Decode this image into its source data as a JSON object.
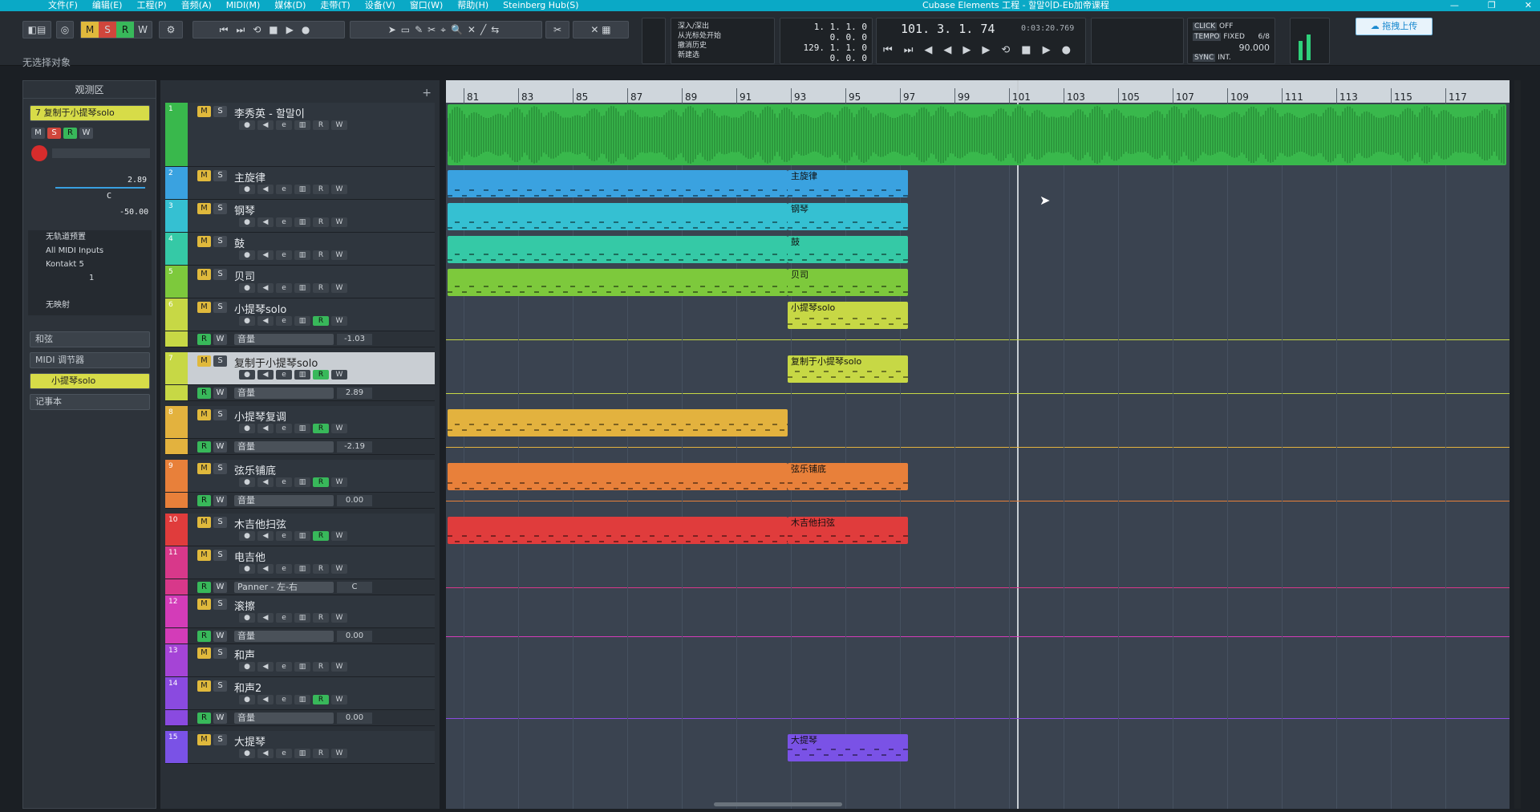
{
  "titlebar": {
    "menus": [
      "文件(F)",
      "编辑(E)",
      "工程(P)",
      "音频(A)",
      "MIDI(M)",
      "媒体(D)",
      "走带(T)",
      "设备(V)",
      "窗口(W)",
      "帮助(H)",
      "Steinberg Hub(S)"
    ],
    "title": "Cubase Elements 工程 - 할말이D-Eb加帝课程"
  },
  "toolbar": {
    "mode_buttons": [
      "M",
      "S",
      "R",
      "W"
    ],
    "no_selection": "无选择对象",
    "history": [
      "深入/深出",
      "从光标处开始",
      "撤消历史",
      "新建选"
    ],
    "left_locator": "1. 1. 1. 0",
    "left_locator2": "0. 0. 0",
    "right_locator": "129. 1. 1. 0",
    "right_locator2": "0. 0. 0",
    "position_bars": "101. 3. 1. 74",
    "position_time": "0:03:20.769",
    "click_label": "CLICK",
    "click_value": "OFF",
    "tempo_label": "TEMPO",
    "tempo_mode": "FIXED",
    "tempo_sig": "6/8",
    "tempo_value": "90.000",
    "sync_label": "SYNC",
    "sync_value": "INT.",
    "upload": "拖拽上传"
  },
  "inspector": {
    "header": "观测区",
    "track_name": "复制于小提琴solo",
    "track_no": "7",
    "volume": "2.89",
    "pan": "C",
    "extra": "-50.00",
    "input_none": "无轨道预置",
    "midi_input": "All MIDI Inputs",
    "instrument": "Kontakt 5",
    "channel": "1",
    "no_map": "无映射",
    "sections": [
      "和弦",
      "MIDI 调节器",
      "小提琴solo",
      "记事本"
    ]
  },
  "tracks": [
    {
      "no": "1",
      "name": "李秀英 - 할말이",
      "color": "#39b84c",
      "type": "audio"
    },
    {
      "no": "2",
      "name": "主旋律",
      "color": "#3aa2e0",
      "type": "midi"
    },
    {
      "no": "3",
      "name": "钢琴",
      "color": "#35c0d2",
      "type": "midi"
    },
    {
      "no": "4",
      "name": "鼓",
      "color": "#35c9a6",
      "type": "midi"
    },
    {
      "no": "5",
      "name": "贝司",
      "color": "#7dc93c",
      "type": "midi"
    },
    {
      "no": "6",
      "name": "小提琴solo",
      "color": "#c7d845",
      "type": "midi",
      "lane": "音量",
      "lane_val": "-1.03"
    },
    {
      "no": "7",
      "name": "复制于小提琴solo",
      "color": "#c7d845",
      "type": "midi",
      "lane": "音量",
      "lane_val": "2.89"
    },
    {
      "no": "8",
      "name": "小提琴复调",
      "color": "#e3b23e",
      "type": "midi",
      "lane": "音量",
      "lane_val": "-2.19"
    },
    {
      "no": "9",
      "name": "弦乐铺底",
      "color": "#e8803a",
      "type": "midi",
      "lane": "音量",
      "lane_val": "0.00"
    },
    {
      "no": "10",
      "name": "木吉他扫弦",
      "color": "#e03c3c",
      "type": "midi"
    },
    {
      "no": "11",
      "name": "电吉他",
      "color": "#d8388a",
      "type": "midi",
      "lane": "Panner - 左-右",
      "lane_val": "C"
    },
    {
      "no": "12",
      "name": "滚擦",
      "color": "#d33cb8",
      "type": "midi",
      "lane": "音量",
      "lane_val": "0.00"
    },
    {
      "no": "13",
      "name": "和声",
      "color": "#a544d6",
      "type": "midi"
    },
    {
      "no": "14",
      "name": "和声2",
      "color": "#8a4ae0",
      "type": "midi",
      "lane": "音量",
      "lane_val": "0.00"
    },
    {
      "no": "15",
      "name": "大提琴",
      "color": "#7a52e6",
      "type": "midi"
    }
  ],
  "ruler": [
    "81",
    "83",
    "85",
    "87",
    "89",
    "91",
    "93",
    "95",
    "97",
    "99",
    "101",
    "103",
    "105",
    "107",
    "109",
    "111",
    "113",
    "115",
    "117"
  ],
  "parts": [
    {
      "label": "主旋律",
      "color": "#3aa2e0"
    },
    {
      "label": "钢琴",
      "color": "#35c0d2"
    },
    {
      "label": "鼓",
      "color": "#35c9a6"
    },
    {
      "label": "贝司",
      "color": "#7dc93c"
    },
    {
      "label": "小提琴solo",
      "color": "#c7d845"
    },
    {
      "label": "复制于小提琴solo",
      "color": "#c7d845"
    },
    {
      "label": "弦乐铺底",
      "color": "#e8803a"
    },
    {
      "label": "木吉他扫弦",
      "color": "#e03c3c"
    },
    {
      "label": "大提琴",
      "color": "#7a52e6"
    }
  ],
  "colors": {
    "audio": "#39b84c",
    "accent": "#0aa9c6"
  }
}
